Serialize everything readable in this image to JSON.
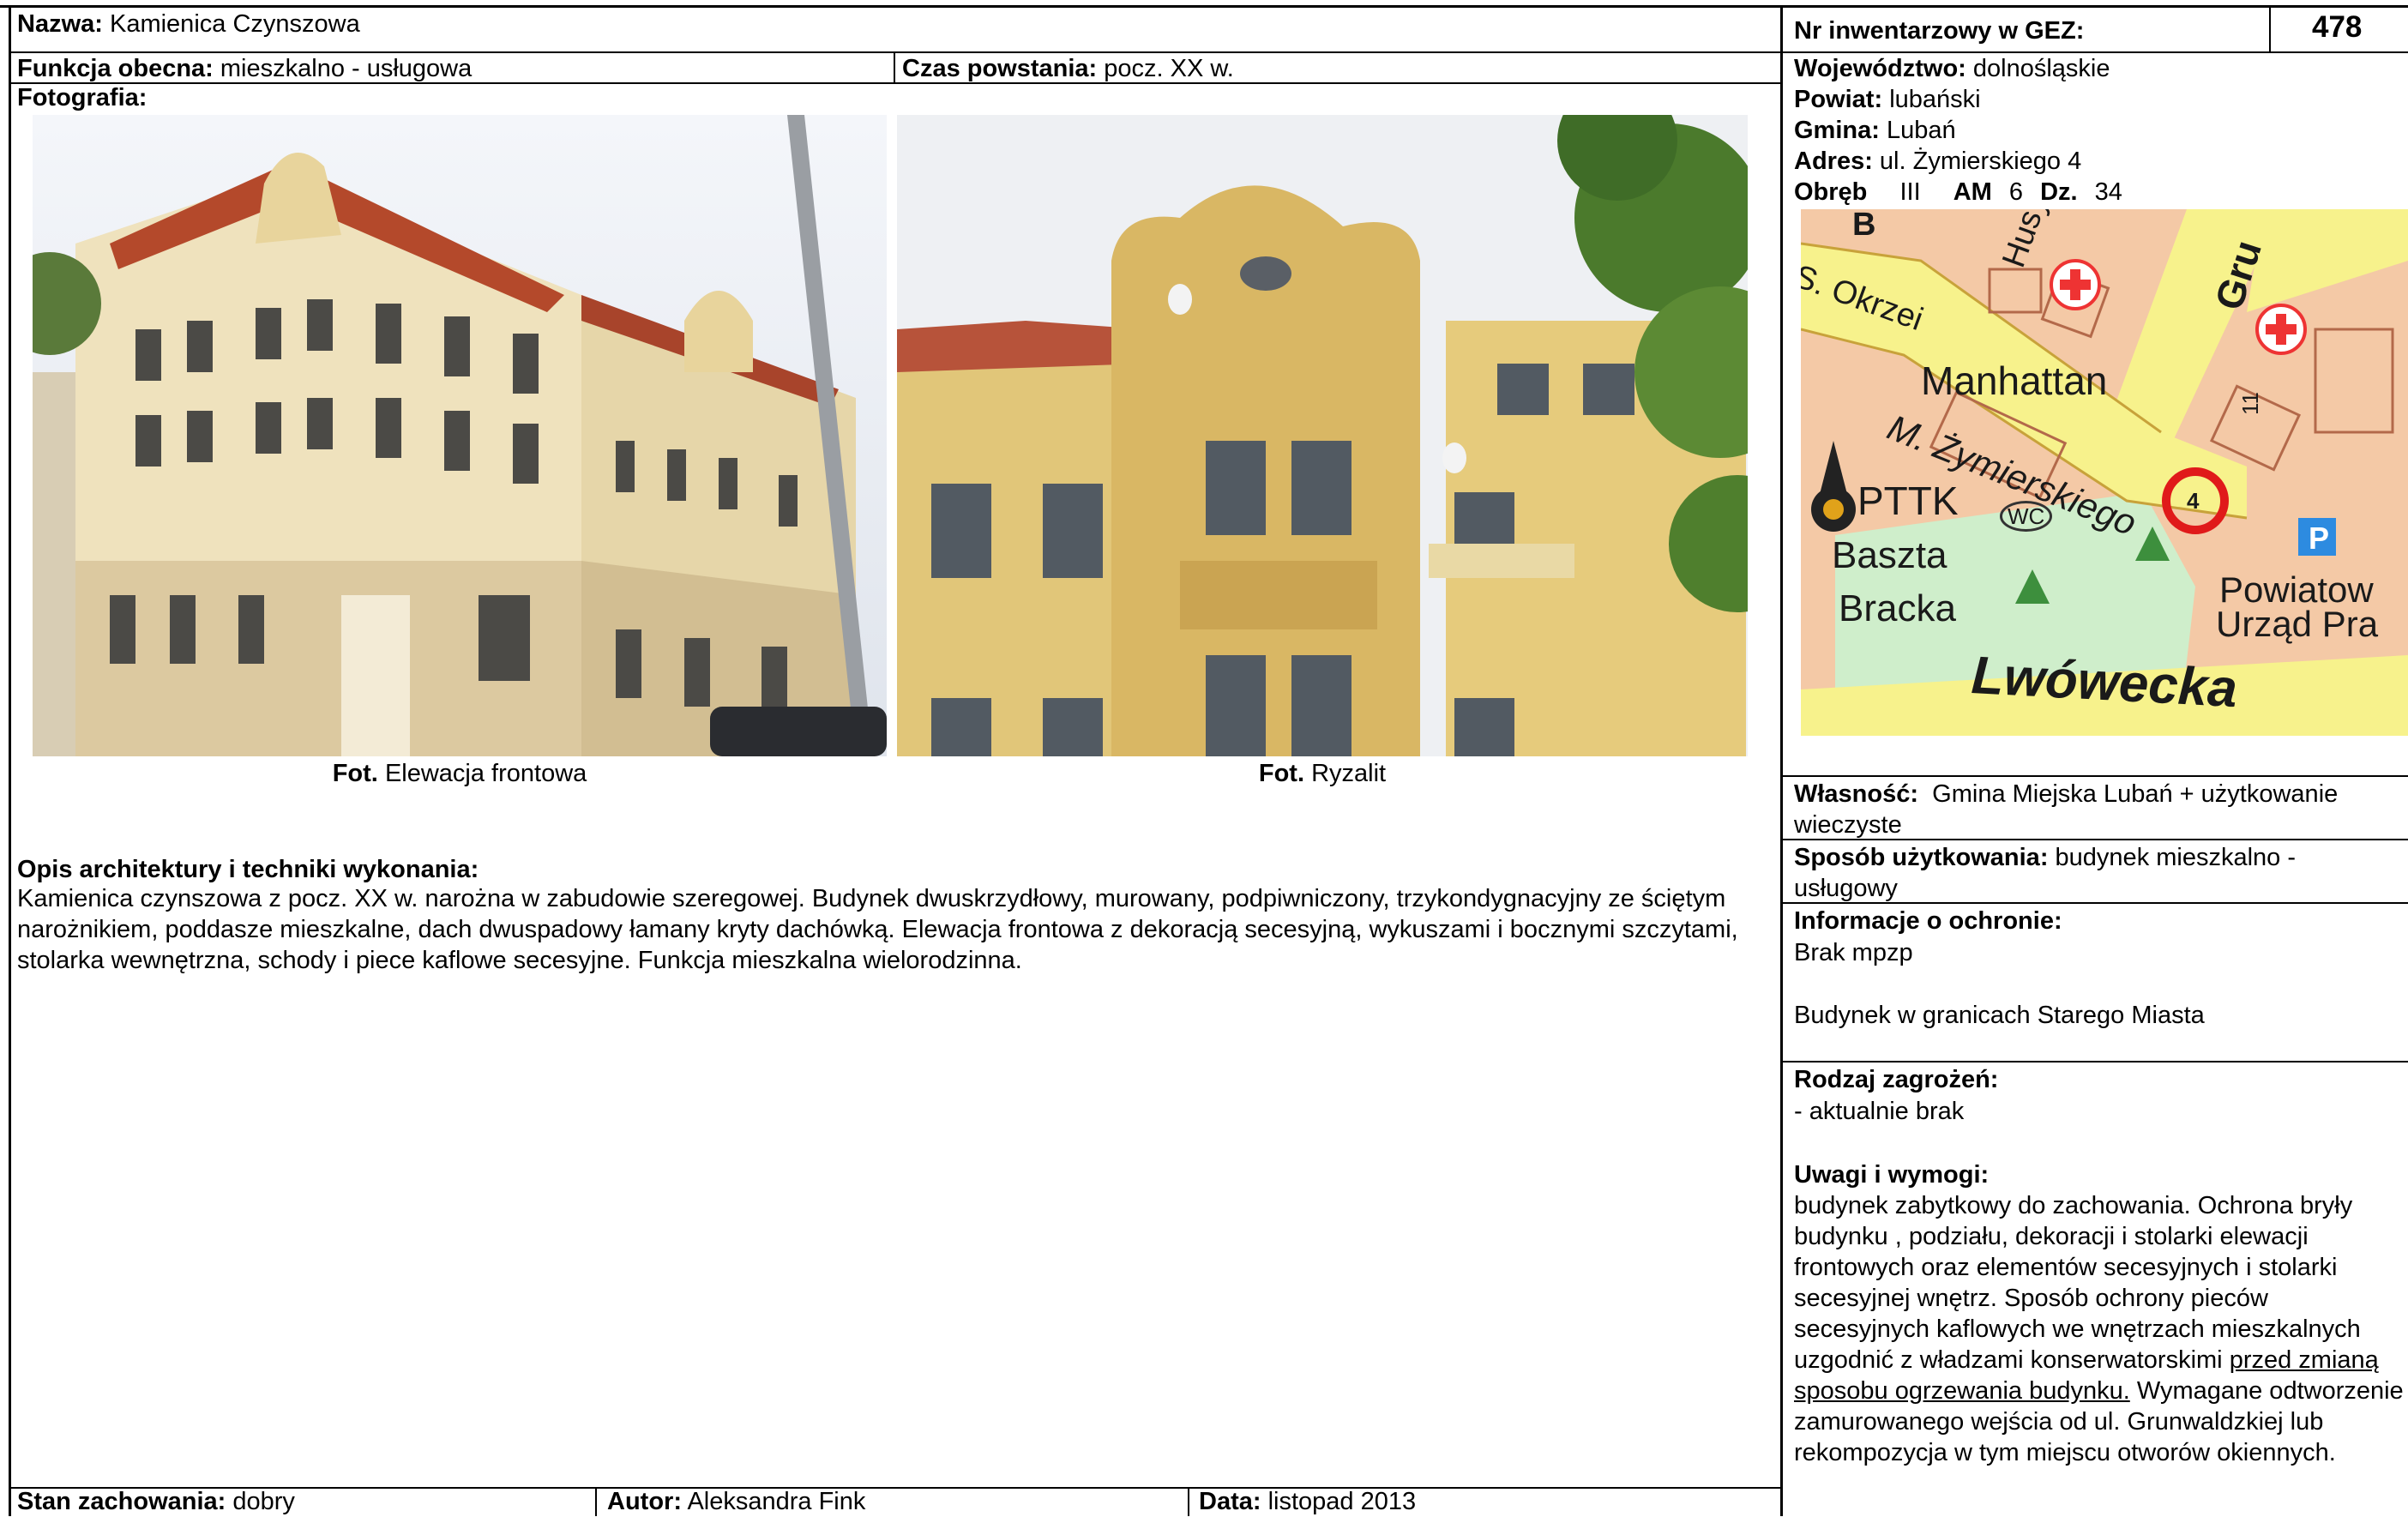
{
  "header": {
    "name_label": "Nazwa:",
    "name_value": "Kamienica Czynszowa",
    "inventory_label": "Nr inwentarzowy w GEZ:",
    "inventory_value": "478",
    "function_label": "Funkcja obecna:",
    "function_value": "mieszkalno - usługowa",
    "time_label": "Czas powstania:",
    "time_value": "pocz. XX w."
  },
  "photos": {
    "section_label": "Fotografia:",
    "items": [
      {
        "caption_label": "Fot.",
        "caption_value": "Elewacja frontowa"
      },
      {
        "caption_label": "Fot.",
        "caption_value": "Ryzalit"
      }
    ]
  },
  "location": {
    "voivodeship_label": "Województwo:",
    "voivodeship_value": "dolnośląskie",
    "county_label": "Powiat:",
    "county_value": "lubański",
    "commune_label": "Gmina:",
    "commune_value": "Lubań",
    "address_label": "Adres:",
    "address_value": "ul. Żymierskiego 4",
    "precinct_label": "Obręb",
    "precinct_value": "III",
    "am_label": "AM",
    "am_value": "6",
    "dz_label": "Dz.",
    "dz_value": "34"
  },
  "map": {
    "labels": [
      "S. Okrzei",
      "Husyto",
      "Manhattan",
      "M. Żymierskiego",
      "PTTK",
      "WC",
      "Baszta",
      "Bracka",
      "Powiatow",
      "Urząd Pra",
      "Lwówecka",
      "Gru",
      "11",
      "4",
      "B"
    ]
  },
  "ownership": {
    "label": "Własność:",
    "value": "Gmina Miejska Lubań + użytkowanie wieczyste"
  },
  "usage": {
    "label": "Sposób użytkowania:",
    "value": "budynek mieszkalno - usługowy"
  },
  "protection": {
    "label": "Informacje o ochronie:",
    "line1": "Brak mpzp",
    "line2": "Budynek w granicach Starego Miasta"
  },
  "threats": {
    "label": "Rodzaj zagrożeń:",
    "value": "- aktualnie brak"
  },
  "remarks": {
    "label": "Uwagi i wymogi:",
    "text_before": "budynek zabytkowy do zachowania. Ochrona bryły budynku , podziału, dekoracji i stolarki elewacji frontowych oraz elementów secesyjnych i stolarki secesyjnej wnętrz. Sposób ochrony pieców secesyjnych kaflowych we wnętrzach mieszkalnych uzgodnić z władzami konserwatorskimi ",
    "text_underlined": "przed zmianą sposobu ogrzewania budynku.",
    "text_after": " Wymagane odtworzenie zamurowanego wejścia od ul. Grunwaldzkiej lub rekompozycja w tym miejscu otworów okiennych."
  },
  "description": {
    "label": "Opis architektury i techniki wykonania:",
    "text": "Kamienica czynszowa z pocz. XX w. narożna w zabudowie szeregowej. Budynek dwuskrzydłowy, murowany, podpiwniczony, trzykondygnacyjny ze ściętym narożnikiem, poddasze mieszkalne, dach dwuspadowy łamany kryty dachówką. Elewacja frontowa z dekoracją secesyjną, wykuszami i bocznymi szczytami, stolarka wewnętrzna, schody i piece kaflowe secesyjne. Funkcja mieszkalna wielorodzinna."
  },
  "footer": {
    "condition_label": "Stan zachowania:",
    "condition_value": "dobry",
    "author_label": "Autor:",
    "author_value": "Aleksandra Fink",
    "date_label": "Data:",
    "date_value": "listopad 2013"
  }
}
